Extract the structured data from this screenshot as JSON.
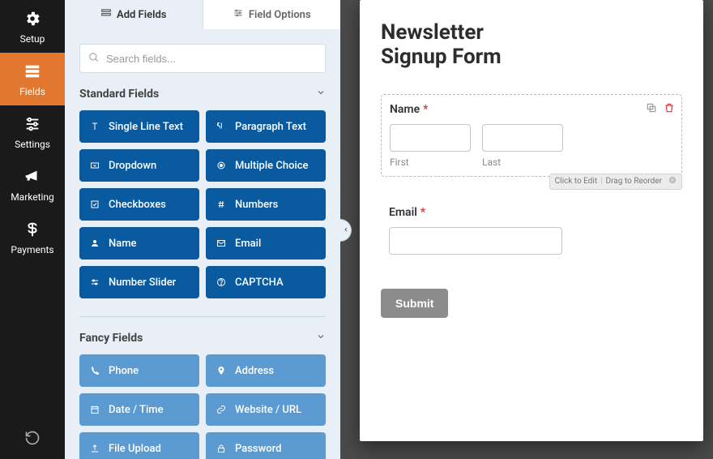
{
  "sidebar": {
    "items": [
      {
        "label": "Setup"
      },
      {
        "label": "Fields"
      },
      {
        "label": "Settings"
      },
      {
        "label": "Marketing"
      },
      {
        "label": "Payments"
      }
    ]
  },
  "tabs": {
    "add": "Add Fields",
    "options": "Field Options"
  },
  "search": {
    "placeholder": "Search fields..."
  },
  "sections": {
    "standard": {
      "title": "Standard Fields",
      "items": [
        {
          "label": "Single Line Text"
        },
        {
          "label": "Paragraph Text"
        },
        {
          "label": "Dropdown"
        },
        {
          "label": "Multiple Choice"
        },
        {
          "label": "Checkboxes"
        },
        {
          "label": "Numbers"
        },
        {
          "label": "Name"
        },
        {
          "label": "Email"
        },
        {
          "label": "Number Slider"
        },
        {
          "label": "CAPTCHA"
        }
      ]
    },
    "fancy": {
      "title": "Fancy Fields",
      "items": [
        {
          "label": "Phone"
        },
        {
          "label": "Address"
        },
        {
          "label": "Date / Time"
        },
        {
          "label": "Website / URL"
        },
        {
          "label": "File Upload"
        },
        {
          "label": "Password"
        }
      ]
    }
  },
  "form": {
    "title": "Newsletter Signup Form",
    "name_field": {
      "label": "Name",
      "first": "First",
      "last": "Last"
    },
    "email_field": {
      "label": "Email"
    },
    "hint": {
      "edit": "Click to Edit",
      "reorder": "Drag to Reorder"
    },
    "submit": "Submit"
  }
}
